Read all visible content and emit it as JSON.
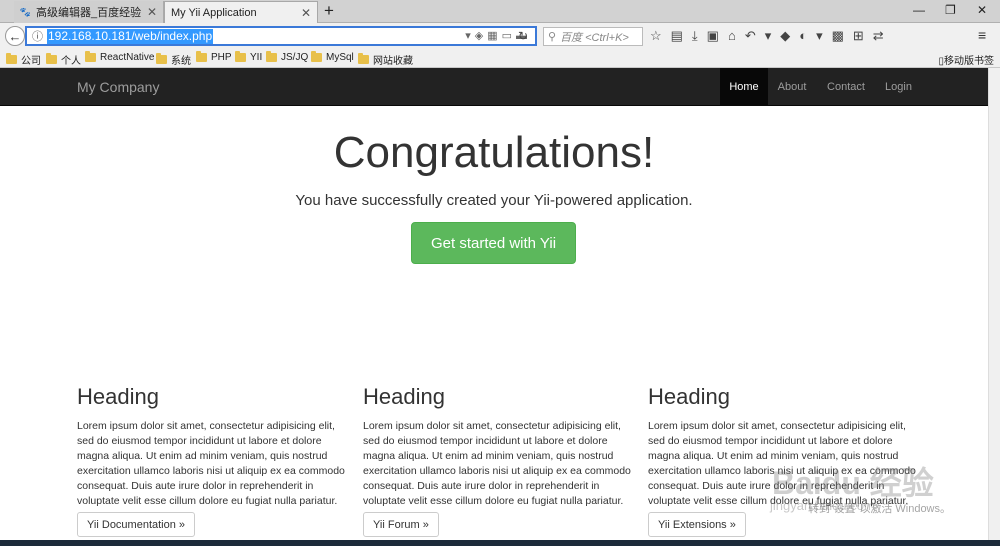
{
  "tabs": [
    {
      "label": "高级编辑器_百度经验",
      "close": "✕"
    },
    {
      "label": "My Yii Application",
      "close": "✕"
    }
  ],
  "new_tab_label": "+",
  "window_controls": [
    "—",
    "❐",
    "✕"
  ],
  "nav": {
    "url": "192.168.10.181/web/index.php",
    "search_placeholder": "百度 <Ctrl+K>"
  },
  "bookmarks": [
    "公司",
    "个人",
    "ReactNative",
    "系统",
    "PHP",
    "YII",
    "JS/JQ",
    "MySql",
    "网站收藏"
  ],
  "mobile_bookmarks": "移动版书签",
  "site": {
    "brand": "My Company",
    "nav": [
      "Home",
      "About",
      "Contact",
      "Login"
    ],
    "active_nav": "Home"
  },
  "jumbotron": {
    "title": "Congratulations!",
    "lead": "You have successfully created your Yii-powered application.",
    "button": "Get started with Yii",
    "button_color": "#5cb85c"
  },
  "columns": [
    {
      "heading": "Heading",
      "body": "Lorem ipsum dolor sit amet, consectetur adipisicing elit, sed do eiusmod tempor incididunt ut labore et dolore magna aliqua. Ut enim ad minim veniam, quis nostrud exercitation ullamco laboris nisi ut aliquip ex ea commodo consequat. Duis aute irure dolor in reprehenderit in voluptate velit esse cillum dolore eu fugiat nulla pariatur.",
      "button": "Yii Documentation »"
    },
    {
      "heading": "Heading",
      "body": "Lorem ipsum dolor sit amet, consectetur adipisicing elit, sed do eiusmod tempor incididunt ut labore et dolore magna aliqua. Ut enim ad minim veniam, quis nostrud exercitation ullamco laboris nisi ut aliquip ex ea commodo consequat. Duis aute irure dolor in reprehenderit in voluptate velit esse cillum dolore eu fugiat nulla pariatur.",
      "button": "Yii Forum »"
    },
    {
      "heading": "Heading",
      "body": "Lorem ipsum dolor sit amet, consectetur adipisicing elit, sed do eiusmod tempor incididunt ut labore et dolore magna aliqua. Ut enim ad minim veniam, quis nostrud exercitation ullamco laboris nisi ut aliquip ex ea commodo consequat. Duis aute irure dolor in reprehenderit in voluptate velit esse cillum dolore eu fugiat nulla pariatur.",
      "button": "Yii Extensions »"
    }
  ],
  "watermark": "Baidu 经验",
  "watermark_url": "jingyan.baidu.com",
  "activate_windows": "转到“设置”以激活 Windows。"
}
